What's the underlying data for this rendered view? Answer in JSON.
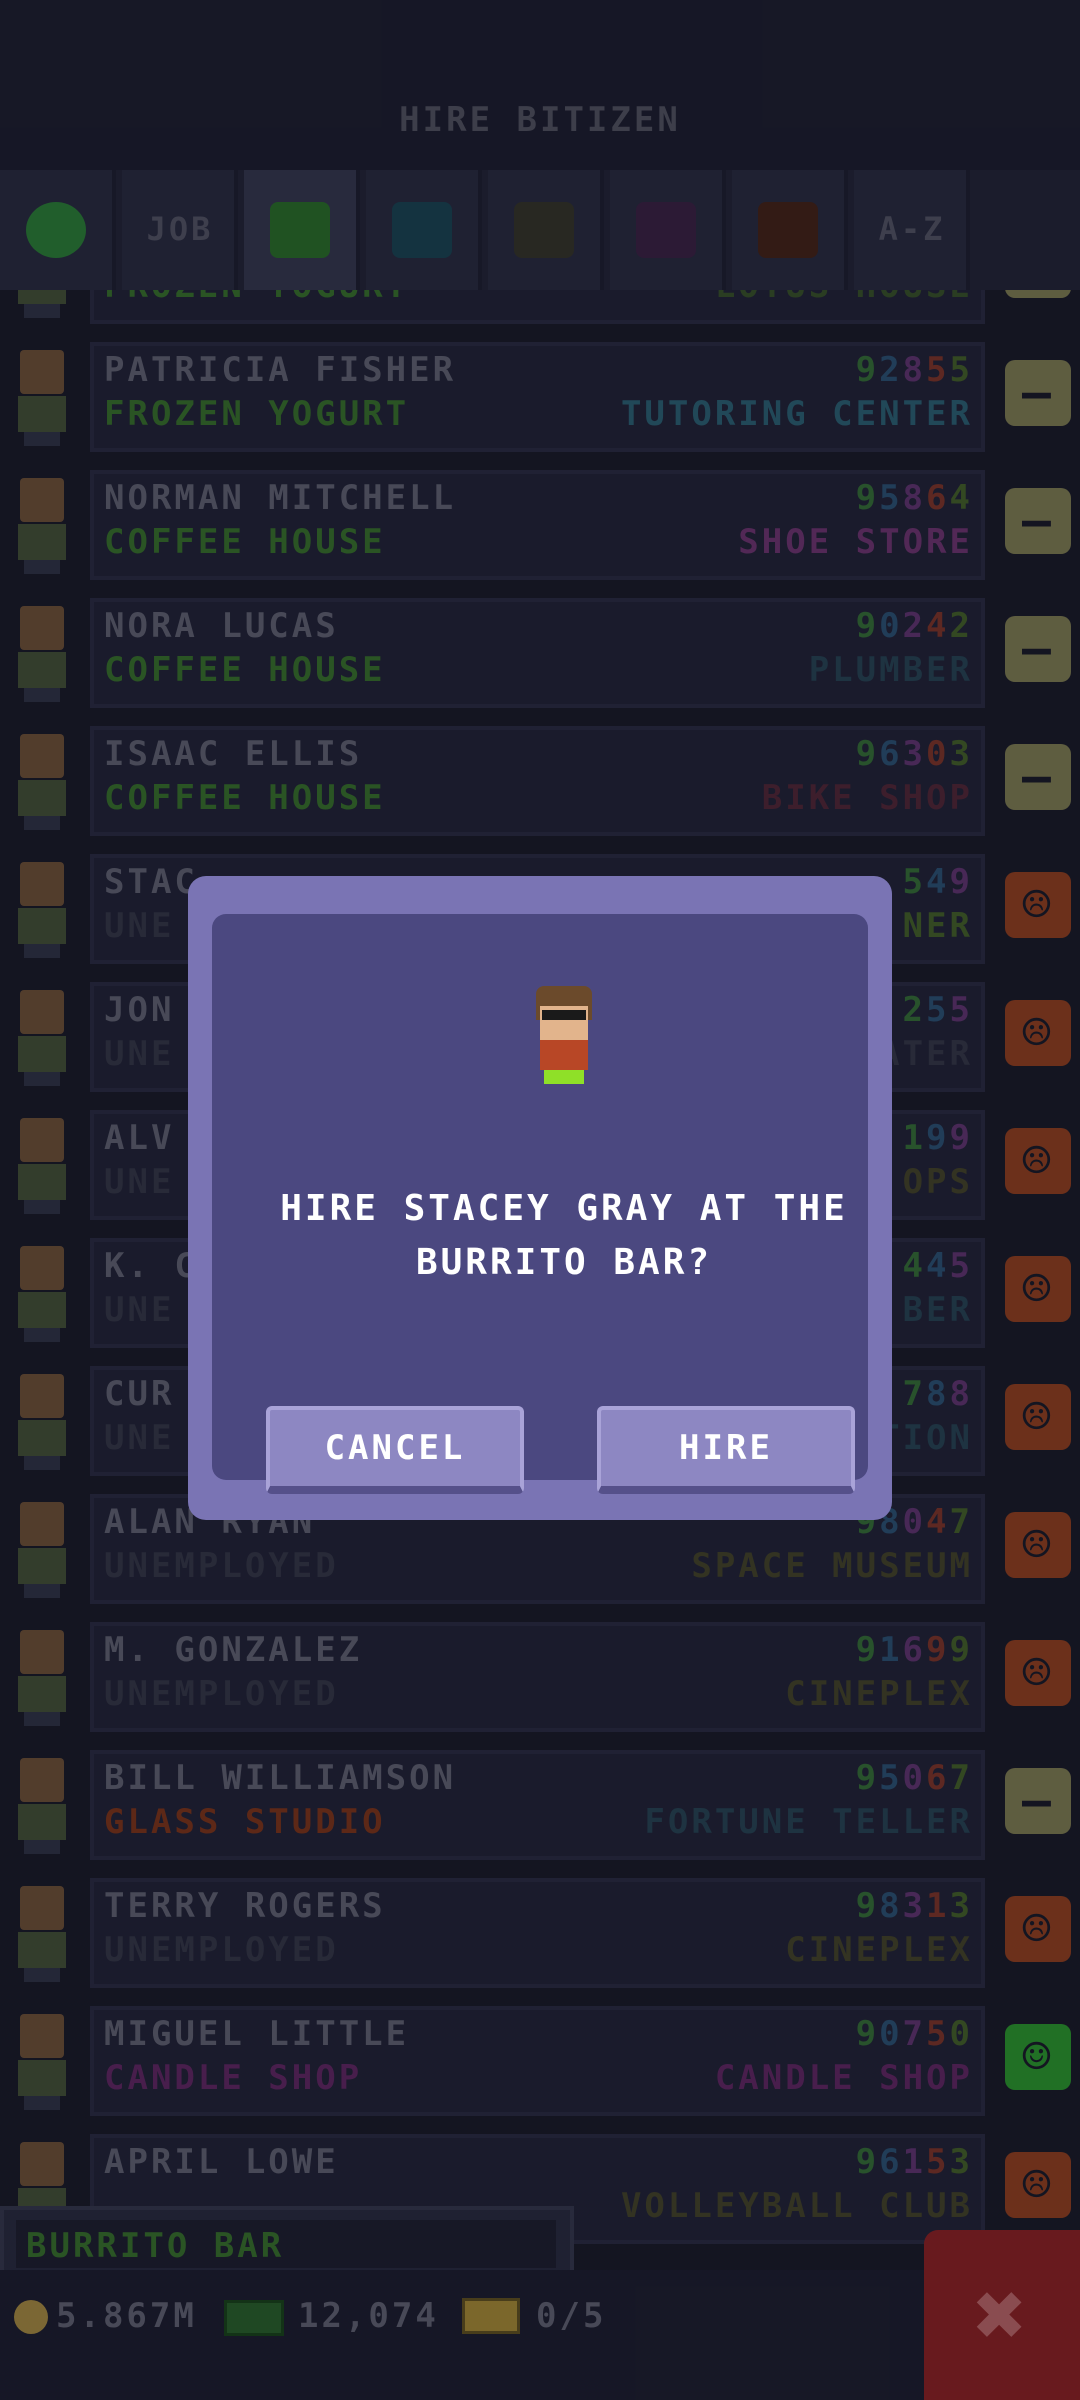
{
  "header": {
    "title": "HIRE BITIZEN"
  },
  "tabs": [
    {
      "kind": "face",
      "color": "#2e8c3a"
    },
    {
      "kind": "text",
      "label": "JOB"
    },
    {
      "kind": "swatch",
      "color": "#2d7a2a",
      "active": true
    },
    {
      "kind": "swatch",
      "color": "#1b4a58"
    },
    {
      "kind": "swatch",
      "color": "#3a3a2a"
    },
    {
      "kind": "swatch",
      "color": "#3f2448"
    },
    {
      "kind": "swatch",
      "color": "#4a2616"
    },
    {
      "kind": "text",
      "label": "A-Z"
    }
  ],
  "rows": [
    {
      "name": "",
      "job": "FROZEN YOGURT",
      "job_color": "#3d7d2d",
      "dream": "LOTUS HOUSE",
      "dream_color": "#3d5a2a",
      "digits": "",
      "mood": "neutral"
    },
    {
      "name": "PATRICIA FISHER",
      "job": "FROZEN YOGURT",
      "job_color": "#3d7d2d",
      "dream": "TUTORING CENTER",
      "dream_color": "#2f6b7d",
      "digits": "92855",
      "mood": "neutral"
    },
    {
      "name": "NORMAN MITCHELL",
      "job": "COFFEE HOUSE",
      "job_color": "#3d7d2d",
      "dream": "SHOE STORE",
      "dream_color": "#7a3a7a",
      "digits": "95864",
      "mood": "neutral"
    },
    {
      "name": "NORA LUCAS",
      "job": "COFFEE HOUSE",
      "job_color": "#3d7d2d",
      "dream": "PLUMBER",
      "dream_color": "#2a4a5a",
      "digits": "90242",
      "mood": "neutral"
    },
    {
      "name": "ISAAC ELLIS",
      "job": "COFFEE HOUSE",
      "job_color": "#3d7d2d",
      "dream": "BIKE SHOP",
      "dream_color": "#5a2a3a",
      "digits": "96303",
      "mood": "neutral"
    },
    {
      "name": "STAC",
      "job": "UNE",
      "job_color": "#3a3c4c",
      "dream": "NER",
      "dream_color": "#4a6a2a",
      "digits": "549",
      "mood": "sad"
    },
    {
      "name": "JON",
      "job": "UNE",
      "job_color": "#3a3c4c",
      "dream": "ATER",
      "dream_color": "#3a3c4c",
      "digits": "255",
      "mood": "sad"
    },
    {
      "name": "ALV",
      "job": "UNE",
      "job_color": "#3a3c4c",
      "dream": "OPS",
      "dream_color": "#4a4a2a",
      "digits": "199",
      "mood": "sad"
    },
    {
      "name": "K. C",
      "job": "UNE",
      "job_color": "#3a3c4c",
      "dream": "BER",
      "dream_color": "#2a4a5a",
      "digits": "445",
      "mood": "sad"
    },
    {
      "name": "CUR",
      "job": "UNE",
      "job_color": "#3a3c4c",
      "dream": "TION",
      "dream_color": "#2a4a5a",
      "digits": "788",
      "mood": "sad"
    },
    {
      "name": "ALAN RYAN",
      "job": "UNEMPLOYED",
      "job_color": "#3a3c4c",
      "dream": "SPACE MUSEUM",
      "dream_color": "#4a4a2a",
      "digits": "98047",
      "mood": "sad"
    },
    {
      "name": "M. GONZALEZ",
      "job": "UNEMPLOYED",
      "job_color": "#3a3c4c",
      "dream": "CINEPLEX",
      "dream_color": "#4a4a2a",
      "digits": "91699",
      "mood": "sad"
    },
    {
      "name": "BILL WILLIAMSON",
      "job": "GLASS STUDIO",
      "job_color": "#8a3a1a",
      "dream": "FORTUNE TELLER",
      "dream_color": "#2a4a5a",
      "digits": "95067",
      "mood": "neutral"
    },
    {
      "name": "TERRY ROGERS",
      "job": "UNEMPLOYED",
      "job_color": "#3a3c4c",
      "dream": "CINEPLEX",
      "dream_color": "#4a4a2a",
      "digits": "98313",
      "mood": "sad"
    },
    {
      "name": "MIGUEL LITTLE",
      "job": "CANDLE SHOP",
      "job_color": "#6a2a6a",
      "dream": "CANDLE SHOP",
      "dream_color": "#6a2a6a",
      "digits": "90750",
      "mood": "happy"
    },
    {
      "name": "APRIL LOWE",
      "job": "",
      "job_color": "#3a3c4c",
      "dream": "VOLLEYBALL CLUB",
      "dream_color": "#4a4a2a",
      "digits": "96153",
      "mood": "sad"
    }
  ],
  "dialog": {
    "message": "HIRE STACEY GRAY AT THE BURRITO BAR?",
    "cancel_label": "CANCEL",
    "hire_label": "HIRE"
  },
  "footer": {
    "building": "BURRITO BAR",
    "coins": "5.867M",
    "bux": "12,074",
    "tickets": "0/5"
  },
  "colors": {
    "mood_neutral": "#8d8a58",
    "mood_sad": "#a2461f",
    "mood_happy": "#2fa82f",
    "digit_cycle": [
      "#3a7a3a",
      "#2f5a7d",
      "#6a3a7a",
      "#8a3a2a",
      "#4a6a2a"
    ]
  }
}
